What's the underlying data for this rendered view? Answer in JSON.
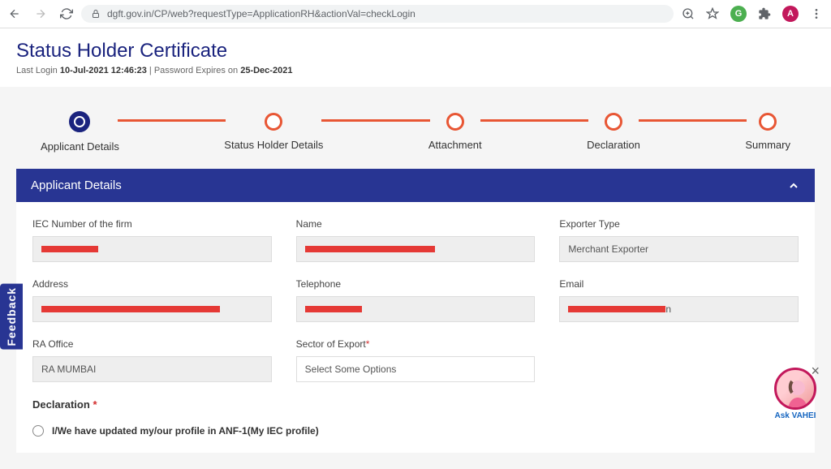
{
  "browser": {
    "url": "dgft.gov.in/CP/web?requestType=ApplicationRH&actionVal=checkLogin",
    "avatar_letter": "A"
  },
  "header": {
    "title": "Status Holder Certificate",
    "last_login_label": "Last Login",
    "last_login_value": "10-Jul-2021 12:46:23",
    "password_expires_label": "Password Expires on",
    "password_expires_value": "25-Dec-2021"
  },
  "steps": [
    {
      "label": "Applicant Details",
      "active": true
    },
    {
      "label": "Status Holder Details",
      "active": false
    },
    {
      "label": "Attachment",
      "active": false
    },
    {
      "label": "Declaration",
      "active": false
    },
    {
      "label": "Summary",
      "active": false
    }
  ],
  "panel": {
    "title": "Applicant Details"
  },
  "form": {
    "iec_label": "IEC Number of the firm",
    "name_label": "Name",
    "exporter_type_label": "Exporter Type",
    "exporter_type_value": "Merchant Exporter",
    "address_label": "Address",
    "telephone_label": "Telephone",
    "email_label": "Email",
    "ra_office_label": "RA Office",
    "ra_office_value": "RA MUMBAI",
    "sector_label": "Sector of Export",
    "sector_placeholder": "Select Some Options",
    "declaration_label": "Declaration",
    "declaration_option": "I/We have updated my/our profile in ANF-1(My IEC profile)"
  },
  "feedback_label": "Feedback",
  "chat": {
    "label": "Ask VAHEI"
  }
}
